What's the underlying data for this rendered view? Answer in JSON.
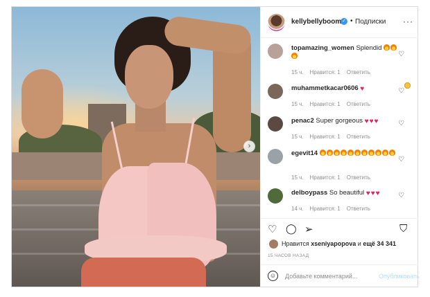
{
  "header": {
    "username": "kellybellyboom",
    "verified_symbol": "✓",
    "separator": "•",
    "follow_label": "Подписки",
    "more_symbol": "···"
  },
  "comments": [
    {
      "user": "topamazing_women",
      "text": "Splendid",
      "emoji_after": [
        "face",
        "face",
        "fire",
        "fire",
        "fire",
        "face"
      ],
      "time": "15 ч.",
      "likes": "Нравится: 1",
      "reply": "Ответить",
      "avatar_color": "#b9a19a"
    },
    {
      "user": "muhammetkacar0606",
      "text": "",
      "emoji_after": [
        "redheart"
      ],
      "time": "15 ч.",
      "likes": "Нравится: 1",
      "reply": "Ответить",
      "avatar_color": "#7a6758"
    },
    {
      "user": "penac2",
      "text": "Super gorgeous",
      "emoji_after": [
        "redheart",
        "redheart",
        "redheart"
      ],
      "time": "15 ч.",
      "likes": "Нравится: 1",
      "reply": "Ответить",
      "avatar_color": "#5a4a42"
    },
    {
      "user": "egevit14",
      "text": "",
      "emoji_after": [
        "fire",
        "fire",
        "fire",
        "fire",
        "fire",
        "fire",
        "fire",
        "fire",
        "fire",
        "fire",
        "fire"
      ],
      "time": "15 ч.",
      "likes": "Нравится: 1",
      "reply": "Ответить",
      "avatar_color": "#9aa2a8"
    },
    {
      "user": "delboypass",
      "text": "So beautiful",
      "emoji_after": [
        "redheart",
        "redheart",
        "redheart"
      ],
      "time": "14 ч.",
      "likes": "Нравится: 1",
      "reply": "Ответить",
      "avatar_color": "#4f6b3a"
    }
  ],
  "heart_symbol": "♡",
  "red_heart_symbol": "♥",
  "actions": {
    "like_symbol": "♡",
    "comment_symbol": "◯",
    "share_symbol": "➢",
    "save_symbol": "⛉"
  },
  "likes": {
    "prefix": "Нравится",
    "user": "xseniyapopova",
    "middle": "и",
    "others": "ещё 34 341"
  },
  "time_ago": "15 ЧАСОВ НАЗАД",
  "comment_box": {
    "placeholder": "Добавьте комментарий...",
    "publish_label": "Опубликовать",
    "smile_symbol": "☺"
  },
  "carousel_next_symbol": "›"
}
